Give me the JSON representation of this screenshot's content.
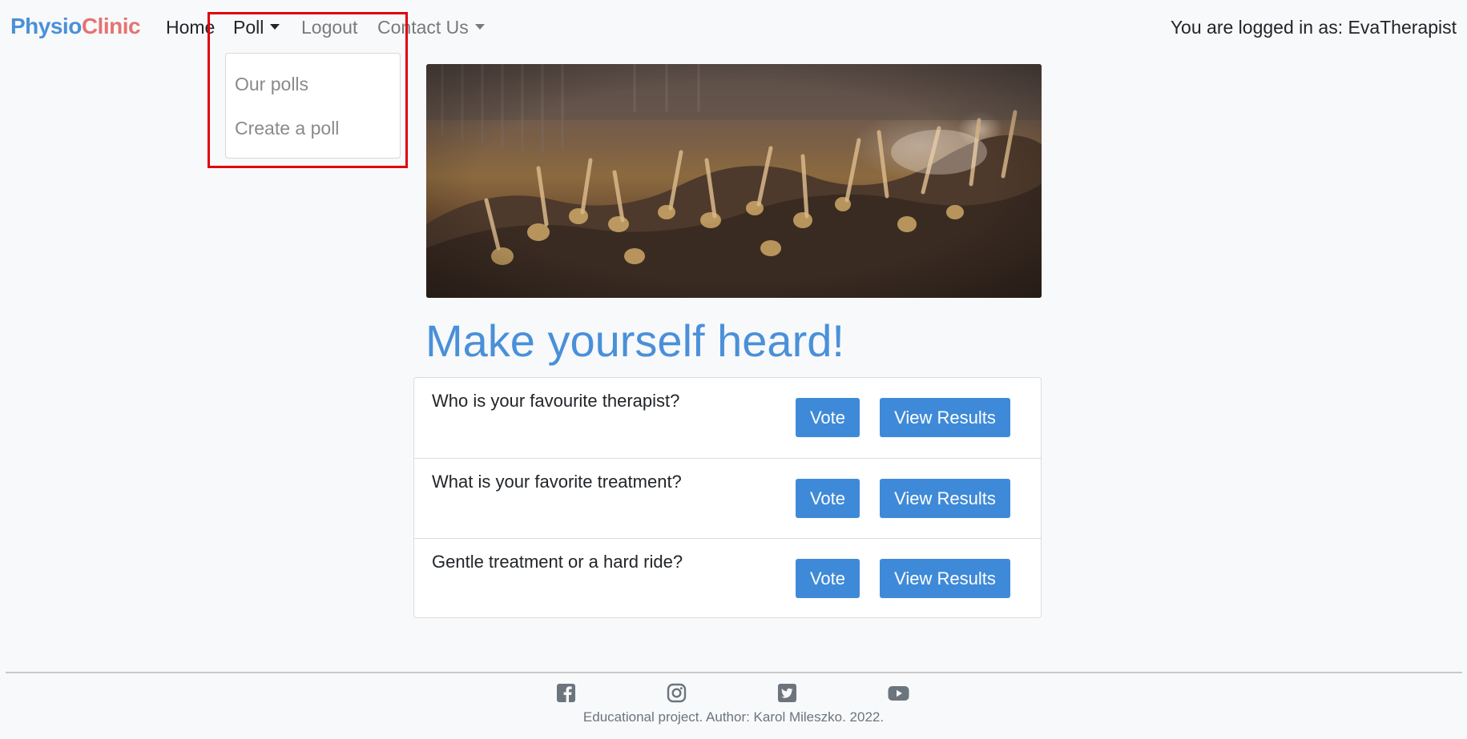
{
  "brand": {
    "part1": "Physio",
    "part2": "Clinic",
    "color1": "#4a90d9",
    "color2": "#e57373"
  },
  "nav": {
    "home": "Home",
    "poll": "Poll",
    "logout": "Logout",
    "contact": "Contact Us"
  },
  "user_info": "You are logged in as: EvaTherapist",
  "dropdown": {
    "items": [
      "Our polls",
      "Create a poll"
    ]
  },
  "heading": "Make yourself heard!",
  "polls": [
    {
      "question": "Who is your favourite therapist?",
      "vote_label": "Vote",
      "results_label": "View Results"
    },
    {
      "question": "What is your favorite treatment?",
      "vote_label": "Vote",
      "results_label": "View Results"
    },
    {
      "question": "Gentle treatment or a hard ride?",
      "vote_label": "Vote",
      "results_label": "View Results"
    }
  ],
  "footer": {
    "text": "Educational project. Author: Karol Mileszko. 2022.",
    "icons": [
      "facebook-icon",
      "instagram-icon",
      "twitter-icon",
      "youtube-icon"
    ]
  },
  "colors": {
    "accent": "#4a90d9",
    "button": "#3f8ad8",
    "highlight": "#e0000f"
  }
}
